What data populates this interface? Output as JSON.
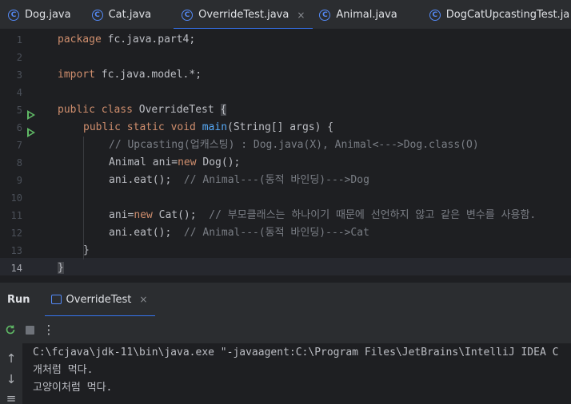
{
  "tabs": [
    {
      "label": "Dog.java",
      "icon": "class-icon",
      "active": false
    },
    {
      "label": "Cat.java",
      "icon": "class-icon",
      "active": false
    },
    {
      "label": "OverrideTest.java",
      "icon": "class-icon",
      "active": true
    },
    {
      "label": "Animal.java",
      "icon": "class-icon",
      "active": false
    },
    {
      "label": "DogCatUpcastingTest.ja",
      "icon": "class-icon",
      "active": false
    }
  ],
  "editor": {
    "line_numbers": [
      "1",
      "2",
      "3",
      "4",
      "5",
      "6",
      "7",
      "8",
      "9",
      "10",
      "11",
      "12",
      "13",
      "14"
    ],
    "current_line": "14",
    "code": {
      "l1_kw": "package",
      "l1_rest": " fc.java.part4;",
      "l3_kw": "import",
      "l3_rest": " fc.java.model.*;",
      "l5_kw": "public class",
      "l5_name": " OverrideTest ",
      "l5_brace": "{",
      "l6_kw": "public static void",
      "l6_fn": "main",
      "l6_rest": "(String[] args) {",
      "l7_comment": "// Upcasting(업캐스팅) : Dog.java(X), Animal<--->Dog.class(O)",
      "l8_a": "Animal ani=",
      "l8_kw": "new",
      "l8_b": " Dog();",
      "l9_code": "ani.eat();  ",
      "l9_comment": "// Animal---(동적 바인딩)--->Dog",
      "l11_a": "ani=",
      "l11_kw": "new",
      "l11_b": " Cat();  ",
      "l11_comment": "// 부모클래스는 하나이기 때문에 선언하지 않고 같은 변수를 사용함.",
      "l12_code": "ani.eat();  ",
      "l12_comment": "// Animal---(동적 바인딩)--->Cat",
      "l13": "}",
      "l14": "}"
    }
  },
  "run_panel": {
    "title": "Run",
    "tab_label": "OverrideTest",
    "close_symbol": "×",
    "toolbar_icons": [
      "rerun-icon",
      "stop-icon",
      "more-options-icon"
    ],
    "console_lines": [
      "C:\\fcjava\\jdk-11\\bin\\java.exe \"-javaagent:C:\\Program Files\\JetBrains\\IntelliJ IDEA C",
      "개처럼 먹다.",
      "고양이처럼 먹다."
    ]
  },
  "colors": {
    "keyword": "#cf8e6d",
    "function": "#56a8f5",
    "comment": "#7a7e85",
    "accent": "#3574f0",
    "run_gutter": "#5fb865"
  }
}
